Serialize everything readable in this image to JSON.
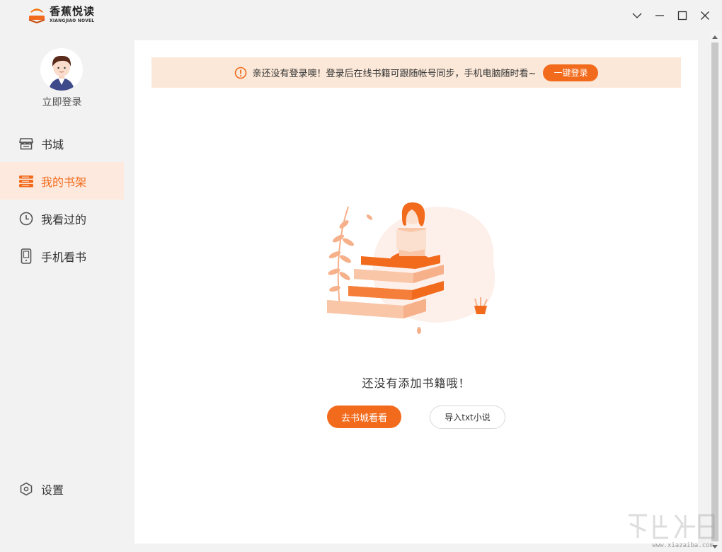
{
  "app": {
    "logo_name": "香蕉悦读",
    "logo_subtitle": "XIANGJIAO NOVEL"
  },
  "user": {
    "login_label": "立即登录"
  },
  "nav": {
    "items": [
      {
        "label": "书城",
        "icon": "store-icon",
        "active": false
      },
      {
        "label": "我的书架",
        "icon": "bookshelf-icon",
        "active": true
      },
      {
        "label": "我看过的",
        "icon": "clock-icon",
        "active": false
      },
      {
        "label": "手机看书",
        "icon": "phone-icon",
        "active": false
      }
    ],
    "settings_label": "设置"
  },
  "banner": {
    "message": "亲还没有登录噢！登录后在线书籍可跟随帐号同步，手机电脑随时看~",
    "button_label": "一键登录"
  },
  "empty_state": {
    "message": "还没有添加书籍哦！",
    "primary_button": "去书城看看",
    "secondary_button": "导入txt小说"
  },
  "watermark": {
    "text": "www.xiazaiba.com"
  },
  "colors": {
    "accent": "#f26b1d",
    "banner_bg": "#fbe8d8",
    "active_nav_bg": "#fde9dd",
    "sidebar_bg": "#f2f2f2"
  }
}
